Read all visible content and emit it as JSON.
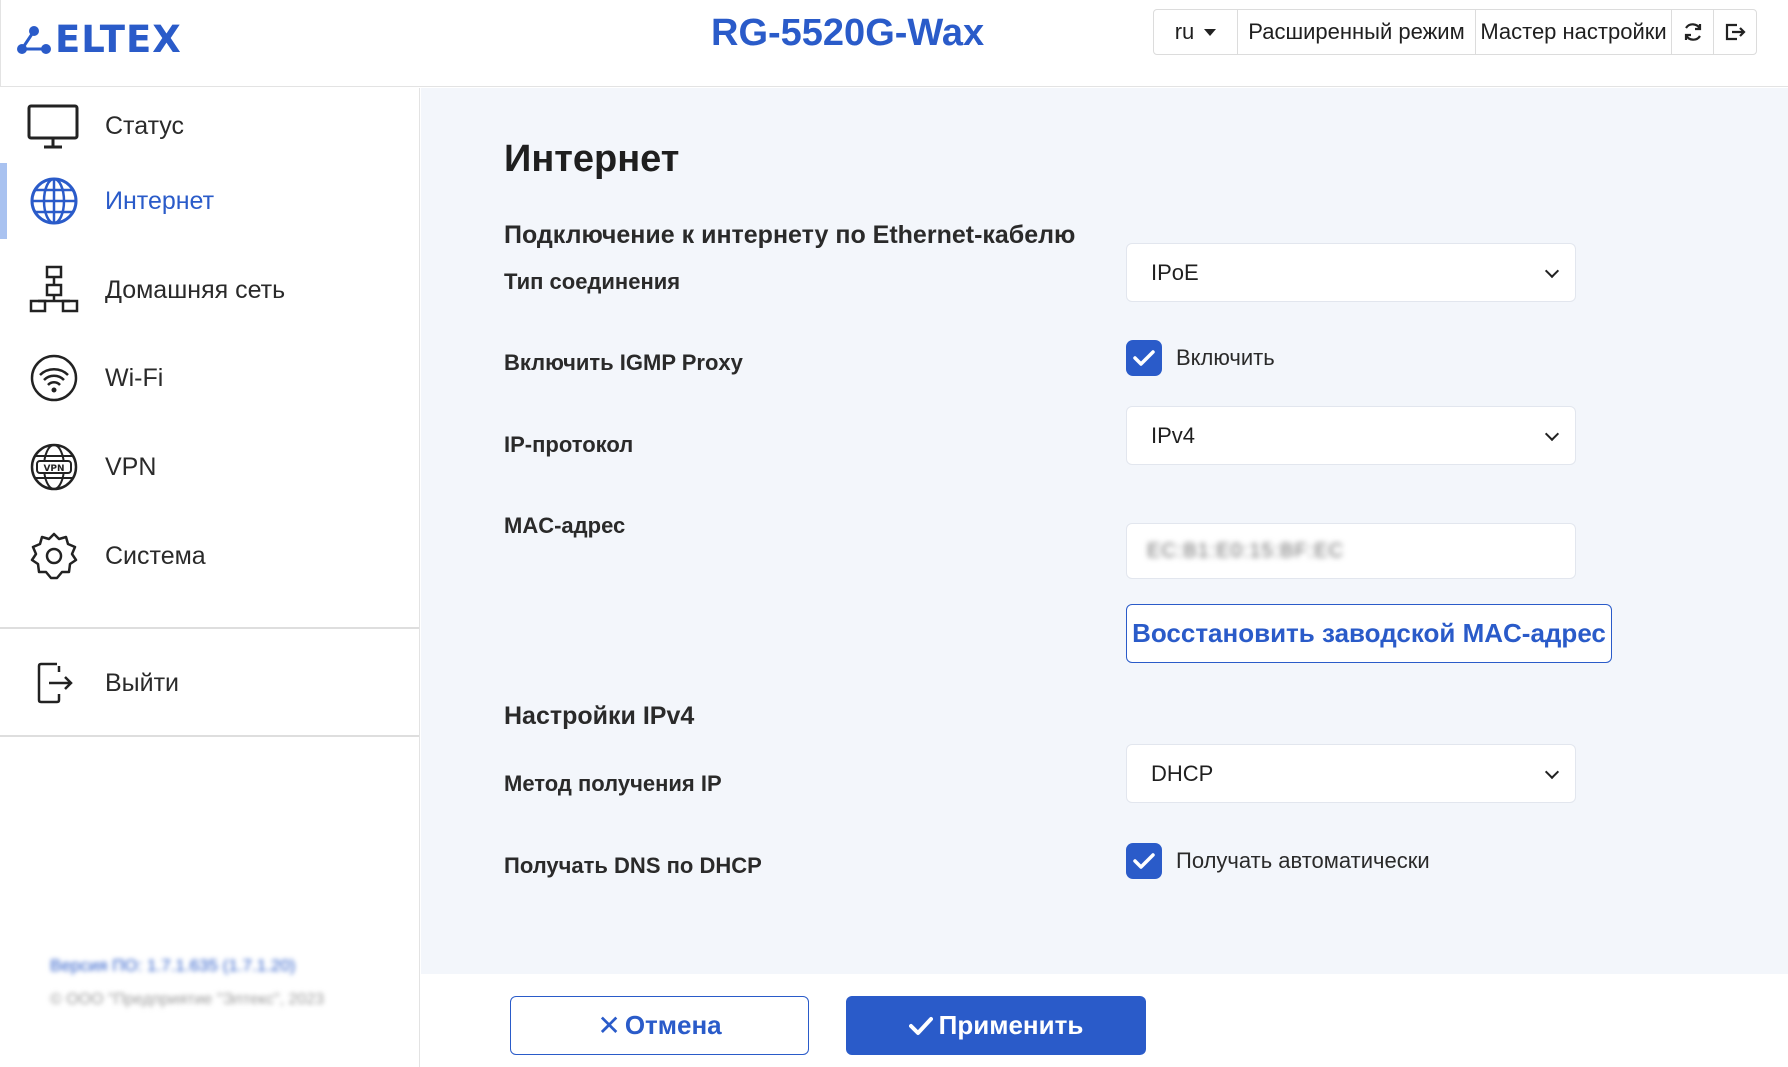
{
  "header": {
    "logo_text": "ELTEX",
    "model": "RG-5520G-Wax",
    "toolbar": {
      "lang": "ru",
      "advanced_mode": "Расширенный режим",
      "setup_wizard": "Мастер настройки",
      "refresh_icon": "refresh-icon",
      "logout_icon": "logout-icon"
    }
  },
  "sidebar": {
    "items": [
      {
        "label": "Статус",
        "icon": "monitor-icon"
      },
      {
        "label": "Интернет",
        "icon": "globe-icon",
        "active": true
      },
      {
        "label": "Домашняя сеть",
        "icon": "network-icon"
      },
      {
        "label": "Wi-Fi",
        "icon": "wifi-icon"
      },
      {
        "label": "VPN",
        "icon": "vpn-globe-icon"
      },
      {
        "label": "Система",
        "icon": "gear-icon"
      }
    ],
    "logout": {
      "label": "Выйти",
      "icon": "exit-icon"
    },
    "version": "Версия ПО: 1.7.1.635 (1.7.1.20)",
    "copyright": "© ООО \"Предприятие \"Элтекс\", 2023"
  },
  "main": {
    "title": "Интернет",
    "section_ethernet": "Подключение к интернету по Ethernet-кабелю",
    "connection_type": {
      "label": "Тип соединения",
      "value": "IPoE"
    },
    "igmp_proxy": {
      "label": "Включить IGMP Proxy",
      "checkbox_label": "Включить",
      "checked": true
    },
    "ip_protocol": {
      "label": "IP-протокол",
      "value": "IPv4"
    },
    "mac_address": {
      "label": "MAC-адрес",
      "value": "EC:B1:E0:15:BF:EC"
    },
    "restore_mac_button": "Восстановить заводской MAC-адрес",
    "section_ipv4": "Настройки IPv4",
    "ip_method": {
      "label": "Метод получения IP",
      "value": "DHCP"
    },
    "dns_dhcp": {
      "label": "Получать DNS по DHCP",
      "checkbox_label": "Получать автоматически",
      "checked": true
    }
  },
  "footer": {
    "cancel": "Отмена",
    "apply": "Применить"
  },
  "colors": {
    "accent": "#2a5bc9",
    "main_bg": "#f3f6fb",
    "active_indicator": "#a9c2f0"
  }
}
